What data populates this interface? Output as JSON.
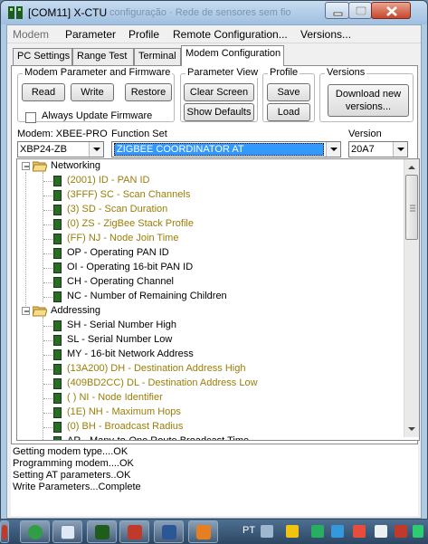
{
  "window": {
    "title": "[COM11] X-CTU",
    "ghost_title": "configuração · Rede de sensores sem fio"
  },
  "menu": [
    "Modem",
    "Parameter",
    "Profile",
    "Remote Configuration...",
    "Versions..."
  ],
  "tabs": [
    {
      "label": "PC Settings",
      "active": false
    },
    {
      "label": "Range Test",
      "active": false
    },
    {
      "label": "Terminal",
      "active": false
    },
    {
      "label": "Modem Configuration",
      "active": true
    }
  ],
  "groups": {
    "modem_param_fw": {
      "label": "Modem Parameter and Firmware",
      "read": "Read",
      "write": "Write",
      "restore": "Restore",
      "always_update": "Always Update Firmware"
    },
    "param_view": {
      "label": "Parameter View",
      "clear": "Clear Screen",
      "defaults": "Show Defaults"
    },
    "profile": {
      "label": "Profile",
      "save": "Save",
      "load": "Load"
    },
    "versions": {
      "label": "Versions",
      "download": "Download new versions..."
    }
  },
  "modem": {
    "label": "Modem: XBEE-PRO",
    "value": "XBP24-ZB"
  },
  "function_set": {
    "label": "Function Set",
    "value": "ZIGBEE COORDINATOR AT"
  },
  "version": {
    "label": "Version",
    "value": "20A7"
  },
  "tree": {
    "networking": {
      "label": "Networking",
      "items": [
        {
          "text": "(2001) ID - PAN ID",
          "set": true
        },
        {
          "text": "(3FFF) SC - Scan Channels",
          "set": true
        },
        {
          "text": "(3) SD - Scan Duration",
          "set": true
        },
        {
          "text": "(0) ZS - ZigBee Stack Profile",
          "set": true
        },
        {
          "text": "(FF) NJ - Node Join Time",
          "set": true
        },
        {
          "text": "OP - Operating PAN ID",
          "set": false
        },
        {
          "text": "OI - Operating 16-bit PAN ID",
          "set": false
        },
        {
          "text": "CH - Operating Channel",
          "set": false
        },
        {
          "text": "NC - Number of Remaining Children",
          "set": false
        }
      ]
    },
    "addressing": {
      "label": "Addressing",
      "items": [
        {
          "text": "SH - Serial Number High",
          "set": false
        },
        {
          "text": "SL - Serial Number Low",
          "set": false
        },
        {
          "text": "MY - 16-bit Network Address",
          "set": false
        },
        {
          "text": "(13A200) DH - Destination Address High",
          "set": true
        },
        {
          "text": "(409BD2CC) DL - Destination Address Low",
          "set": true
        },
        {
          "text": "( ) NI - Node Identifier",
          "set": true
        },
        {
          "text": "(1E) NH - Maximum Hops",
          "set": true
        },
        {
          "text": "(0) BH - Broadcast Radius",
          "set": true
        },
        {
          "text": "AR - Many-to-One Route Broadcast Time",
          "set": false
        }
      ]
    }
  },
  "log": [
    "Getting modem type....OK",
    "Programming modem....OK",
    "Setting AT parameters..OK",
    "Write Parameters...Complete"
  ],
  "taskbar": {
    "language": "PT"
  }
}
